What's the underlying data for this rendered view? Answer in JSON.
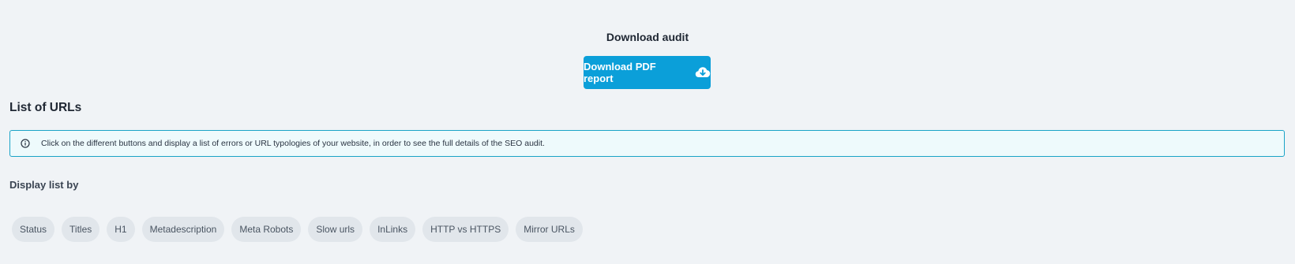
{
  "download": {
    "title": "Download audit",
    "button_label": "Download PDF report",
    "button_icon": "cloud-download-icon",
    "button_color": "#0b9fd9"
  },
  "urls": {
    "title": "List of URLs",
    "info_icon": "info-circle-icon",
    "info_text": "Click on the different buttons and display a list of errors or URL typologies of your website, in order to see the full details of the SEO audit.",
    "info_border_color": "#1aa3c7"
  },
  "display": {
    "title": "Display list by",
    "filters": [
      {
        "label": "Status"
      },
      {
        "label": "Titles"
      },
      {
        "label": "H1"
      },
      {
        "label": "Metadescription"
      },
      {
        "label": "Meta Robots"
      },
      {
        "label": "Slow urls"
      },
      {
        "label": "InLinks"
      },
      {
        "label": "HTTP vs HTTPS"
      },
      {
        "label": "Mirror URLs"
      }
    ]
  }
}
